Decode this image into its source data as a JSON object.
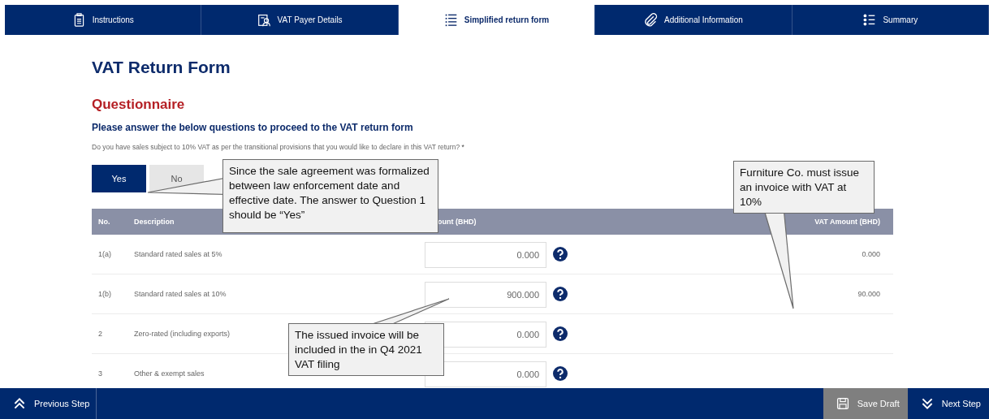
{
  "tabs": [
    {
      "label": "Instructions",
      "selected": false
    },
    {
      "label": "VAT Payer Details",
      "selected": false
    },
    {
      "label": "Simplified return form",
      "selected": true
    },
    {
      "label": "Additional Information",
      "selected": false
    },
    {
      "label": "Summary",
      "selected": false
    }
  ],
  "title": "VAT Return Form",
  "section": "Questionnaire",
  "subtitle": "Please answer the below questions to proceed to the VAT return form",
  "question": {
    "text": "Do you have sales subject to 10% VAT as per the transitional provisions that you would like to declare in this VAT return?",
    "required_mark": "*"
  },
  "answers": [
    {
      "label": "Yes",
      "selected": true
    },
    {
      "label": "No",
      "selected": false
    }
  ],
  "table": {
    "columns": [
      "No.",
      "Description",
      "ount (BHD)",
      "VAT Amount (BHD)"
    ],
    "rows": [
      {
        "no": "1(a)",
        "description": "Standard rated sales at 5%",
        "amount": "0.000",
        "vat": "0.000"
      },
      {
        "no": "1(b)",
        "description": "Standard rated sales at 10%",
        "amount": "900.000",
        "vat": "90.000"
      },
      {
        "no": "2",
        "description": "Zero-rated (including exports)",
        "amount": "0.000"
      },
      {
        "no": "3",
        "description": "Other & exempt sales",
        "amount": "0.000"
      }
    ]
  },
  "callouts": [
    {
      "text": "Since the sale agreement was formalized between law enforcement date and effective date. The answer to Question 1 should be “Yes”"
    },
    {
      "text": "Furniture Co. must issue an invoice with VAT at 10%"
    },
    {
      "text": "The issued invoice will be included in the in Q4 2021 VAT filing"
    }
  ],
  "footer": {
    "previous": "Previous Step",
    "save": "Save Draft",
    "next": "Next Step"
  }
}
